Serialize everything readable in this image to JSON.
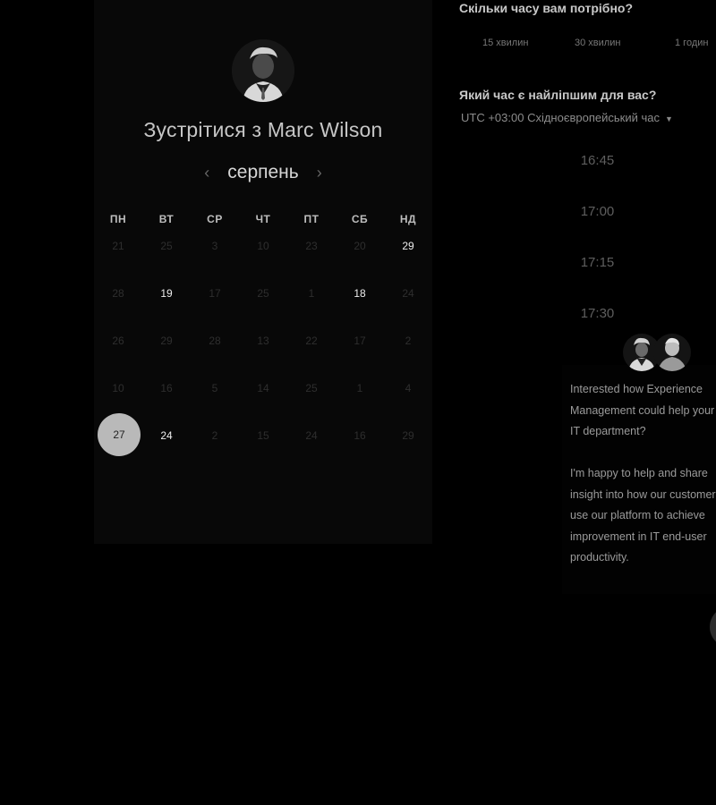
{
  "host": {
    "title_prefix": "Зустрітися з",
    "name": "Marc Wilson"
  },
  "calendar": {
    "month": "серпень",
    "prev_icon": "‹",
    "next_icon": "›",
    "weekdays": [
      "ПН",
      "ВТ",
      "СР",
      "ЧТ",
      "ПТ",
      "СБ",
      "НД"
    ],
    "weeks": [
      [
        {
          "d": "21"
        },
        {
          "d": "25"
        },
        {
          "d": "3"
        },
        {
          "d": "10"
        },
        {
          "d": "23"
        },
        {
          "d": "20"
        },
        {
          "d": "29",
          "avail": true
        }
      ],
      [
        {
          "d": "28"
        },
        {
          "d": "19",
          "avail": true
        },
        {
          "d": "17"
        },
        {
          "d": "25"
        },
        {
          "d": "1"
        },
        {
          "d": "18",
          "avail": true
        },
        {
          "d": "24"
        }
      ],
      [
        {
          "d": "26"
        },
        {
          "d": "29"
        },
        {
          "d": "28"
        },
        {
          "d": "13"
        },
        {
          "d": "22"
        },
        {
          "d": "17"
        },
        {
          "d": "2"
        }
      ],
      [
        {
          "d": "10"
        },
        {
          "d": "16"
        },
        {
          "d": "5"
        },
        {
          "d": "14"
        },
        {
          "d": "25"
        },
        {
          "d": "1"
        },
        {
          "d": "4"
        }
      ],
      [
        {
          "d": "27",
          "selected": true
        },
        {
          "d": "24",
          "avail": true
        },
        {
          "d": "2"
        },
        {
          "d": "15"
        },
        {
          "d": "24"
        },
        {
          "d": "16"
        },
        {
          "d": "29"
        }
      ]
    ]
  },
  "duration": {
    "question": "Скільки часу вам потрібно?",
    "options": [
      "15 хвилин",
      "30 хвилин",
      "1 годин"
    ]
  },
  "time": {
    "question": "Який час є найліпшим для вас?",
    "timezone": "UTC +03:00 Східноєвропейський час",
    "slots": [
      "16:45",
      "17:00",
      "17:15",
      "17:30"
    ]
  },
  "chat": {
    "paragraph1": "Interested how Experience Management could help your IT department?",
    "paragraph2": "I'm happy to help and share insight into how our customers use our platform to achieve improvement in IT end-user productivity."
  },
  "icons": {
    "prev": "chevron-left-icon",
    "next": "chevron-right-icon",
    "caret": "caret-down-icon"
  }
}
